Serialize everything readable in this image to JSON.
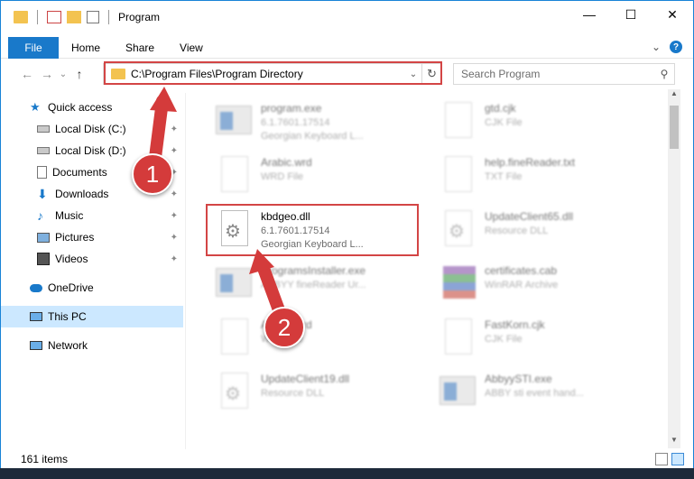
{
  "titlebar": {
    "title": "Program",
    "minimize": "—",
    "maximize": "☐",
    "close": "✕"
  },
  "ribbon": {
    "tabs": [
      "File",
      "Home",
      "Share",
      "View"
    ],
    "expand": "⌄",
    "help": "?"
  },
  "nav": {
    "back": "←",
    "forward": "→",
    "recent": "⌄",
    "up": "↑"
  },
  "address": {
    "path": "C:\\Program Files\\Program Directory",
    "dropdown": "⌄",
    "refresh": "↻"
  },
  "search": {
    "placeholder": "Search Program",
    "icon": "⚲"
  },
  "sidebar": {
    "items": [
      {
        "label": "Quick access",
        "icon": "star-icon"
      },
      {
        "label": "Local Disk (C:)",
        "icon": "drive-icon"
      },
      {
        "label": "Local Disk (D:)",
        "icon": "drive-icon"
      },
      {
        "label": "Documents",
        "icon": "documents-icon"
      },
      {
        "label": "Downloads",
        "icon": "download-icon"
      },
      {
        "label": "Music",
        "icon": "music-icon"
      },
      {
        "label": "Pictures",
        "icon": "pictures-icon"
      },
      {
        "label": "Videos",
        "icon": "videos-icon"
      },
      {
        "label": "OneDrive",
        "icon": "cloud-icon"
      },
      {
        "label": "This PC",
        "icon": "pc-icon"
      },
      {
        "label": "Network",
        "icon": "network-icon"
      }
    ],
    "pin": "📌"
  },
  "files": [
    {
      "name": "program.exe",
      "line1": "6.1.7601.17514",
      "line2": "Georgian Keyboard L...",
      "icon": "app-icon"
    },
    {
      "name": "gtd.cjk",
      "line1": "CJK File",
      "line2": "",
      "icon": "document-icon"
    },
    {
      "name": "Arabic.wrd",
      "line1": "WRD File",
      "line2": "",
      "icon": "document-icon"
    },
    {
      "name": "help.fineReader.txt",
      "line1": "TXT File",
      "line2": "",
      "icon": "document-icon"
    },
    {
      "name": "kbdgeo.dll",
      "line1": "6.1.7601.17514",
      "line2": "Georgian Keyboard L...",
      "icon": "dll-icon"
    },
    {
      "name": "UpdateClient65.dll",
      "line1": "Resource DLL",
      "line2": "",
      "icon": "dll-icon"
    },
    {
      "name": "ProgramsInstaller.exe",
      "line1": "ABBYY fineReader Ur...",
      "line2": "",
      "icon": "app-icon"
    },
    {
      "name": "certificates.cab",
      "line1": "WinRAR Archive",
      "line2": "",
      "icon": "archive-icon"
    },
    {
      "name": "Arabic.wrd",
      "line1": "WRD File",
      "line2": "",
      "icon": "document-icon"
    },
    {
      "name": "FastKorn.cjk",
      "line1": "CJK File",
      "line2": "",
      "icon": "document-icon"
    },
    {
      "name": "UpdateClient19.dll",
      "line1": "Resource DLL",
      "line2": "",
      "icon": "dll-icon"
    },
    {
      "name": "AbbyySTI.exe",
      "line1": "ABBY sti event hand...",
      "line2": "",
      "icon": "app-icon"
    }
  ],
  "status": {
    "count": "161 items"
  },
  "annotations": {
    "step1": "1",
    "step2": "2",
    "color": "#d43b3b"
  }
}
